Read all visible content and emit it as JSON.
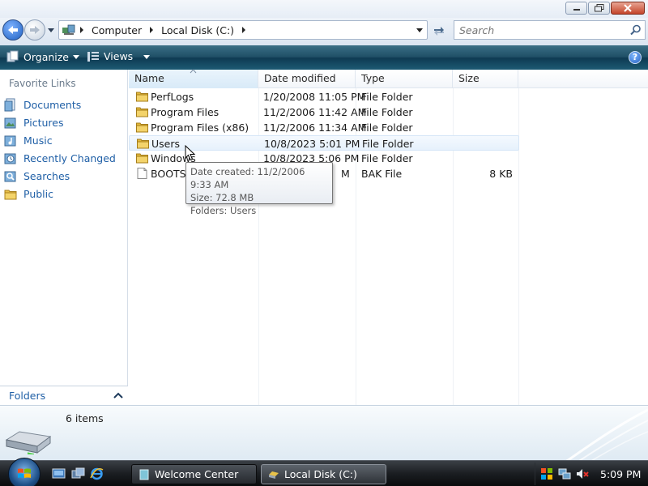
{
  "address": {
    "crumbs": [
      "Computer",
      "Local Disk (C:)"
    ]
  },
  "search": {
    "placeholder": "Search"
  },
  "toolbar": {
    "organize_label": "Organize",
    "views_label": "Views",
    "help_label": "?"
  },
  "navpane": {
    "header": "Favorite Links",
    "items": [
      {
        "label": "Documents",
        "icon": "documents-icon"
      },
      {
        "label": "Pictures",
        "icon": "pictures-icon"
      },
      {
        "label": "Music",
        "icon": "music-icon"
      },
      {
        "label": "Recently Changed",
        "icon": "recently-changed-icon"
      },
      {
        "label": "Searches",
        "icon": "searches-icon"
      },
      {
        "label": "Public",
        "icon": "public-folder-icon"
      }
    ],
    "folders_label": "Folders"
  },
  "columns": {
    "name": "Name",
    "date": "Date modified",
    "type": "Type",
    "size": "Size"
  },
  "files": [
    {
      "name": "PerfLogs",
      "date": "1/20/2008 11:05 PM",
      "type": "File Folder",
      "size": "",
      "icon": "folder-icon"
    },
    {
      "name": "Program Files",
      "date": "11/2/2006 11:42 AM",
      "type": "File Folder",
      "size": "",
      "icon": "folder-icon"
    },
    {
      "name": "Program Files (x86)",
      "date": "11/2/2006 11:34 AM",
      "type": "File Folder",
      "size": "",
      "icon": "folder-icon"
    },
    {
      "name": "Users",
      "date": "10/8/2023 5:01 PM",
      "type": "File Folder",
      "size": "",
      "icon": "folder-icon"
    },
    {
      "name": "Windows",
      "date": "10/8/2023 5:06 PM",
      "type": "File Folder",
      "size": "",
      "icon": "folder-icon"
    },
    {
      "name": "BOOTSE",
      "date": "M",
      "type": "BAK File",
      "size": "8 KB",
      "icon": "file-icon"
    }
  ],
  "tooltip": {
    "date_created": "Date created: 11/2/2006 9:33 AM",
    "size": "Size: 72.8 MB",
    "folders": "Folders: Users"
  },
  "details": {
    "item_count": "6 items"
  },
  "taskbar": {
    "tasks": [
      {
        "label": "Welcome Center"
      },
      {
        "label": "Local Disk (C:)"
      }
    ],
    "clock": "5:09 PM"
  },
  "colors": {
    "toolbar": "#1f4f66",
    "link": "#1f5fa6",
    "taskbar": "#1b1e22"
  }
}
